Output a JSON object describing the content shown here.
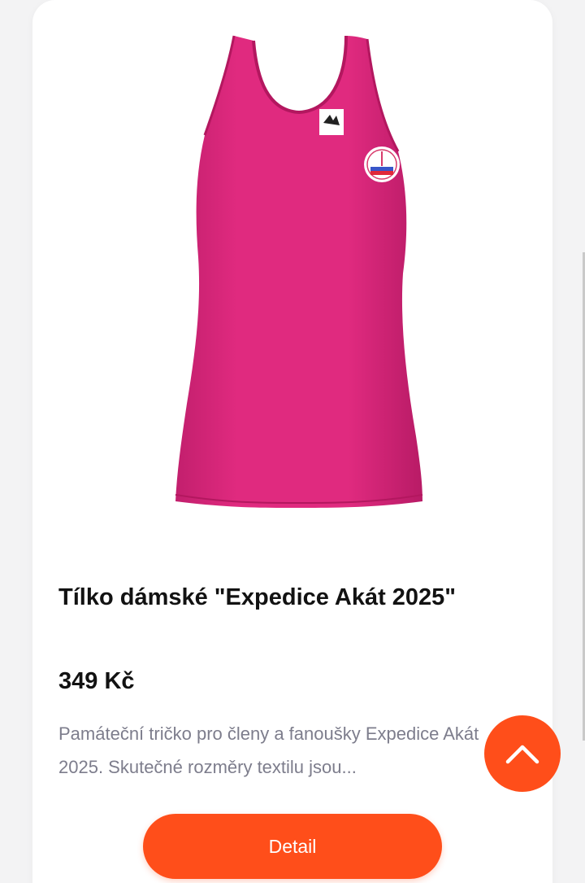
{
  "product": {
    "title": "Tílko dámské \"Expedice Akát 2025\"",
    "price": "349 Kč",
    "description": "Památeční tričko pro členy a fanoušky Expedice Akát 2025. Skutečné rozměry textilu jsou...",
    "image_icon": "pink-tank-top-image",
    "image_color": "#e02a7f"
  },
  "actions": {
    "detail_label": "Detail",
    "scroll_top_icon": "chevron-up-icon"
  },
  "colors": {
    "accent": "#ff4e1a",
    "title": "#121212",
    "description": "#7d7d8c"
  }
}
